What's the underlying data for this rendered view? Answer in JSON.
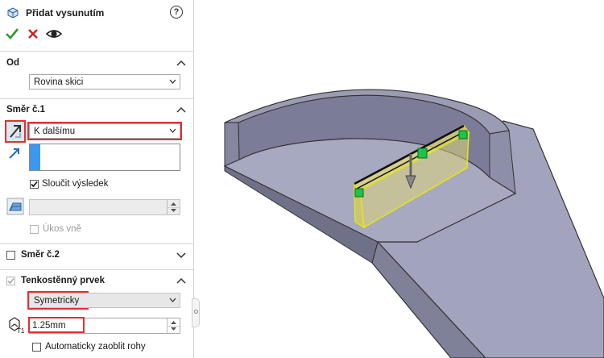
{
  "panel": {
    "title": "Přidat vysunutím",
    "help_symbol": "?",
    "actions": {
      "ok": "check-icon",
      "cancel": "close-icon",
      "preview": "eye-icon"
    }
  },
  "from_section": {
    "title": "Od",
    "start_condition": "Rovina skici"
  },
  "direction1": {
    "title": "Směr č.1",
    "end_condition": "K dalšímu",
    "selection_value": "",
    "merge_result_label": "Sloučit výsledek",
    "merge_result_checked": true,
    "draft_value": "",
    "draft_outward_label": "Úkos vně",
    "draft_outward_checked": false
  },
  "direction2": {
    "title": "Směr č.2",
    "checked": false
  },
  "thin_feature": {
    "title": "Tenkostěnný prvek",
    "checked": true,
    "type": "Symetricky",
    "thickness": "1.25mm",
    "auto_fillet_label": "Automaticky zaoblit rohy",
    "auto_fillet_checked": false
  },
  "colors": {
    "highlight": "#e03131",
    "accent_blue": "#3d96f0",
    "ok_green": "#2e9b2e",
    "cancel_red": "#d21f1f",
    "model_face": "#9a9cb3",
    "preview_yellow": "#f2f24a",
    "handle_green": "#1fc24a"
  }
}
